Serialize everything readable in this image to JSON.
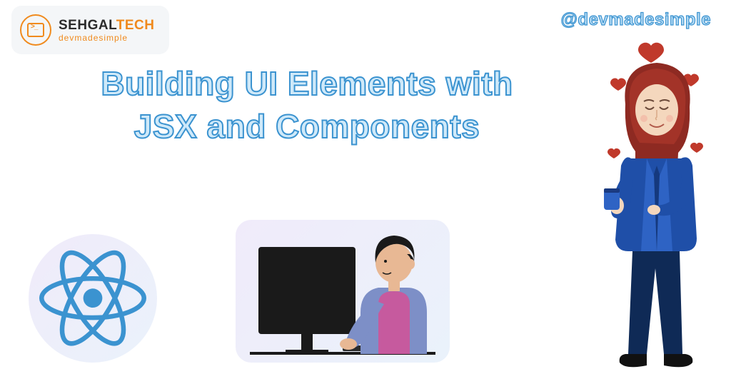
{
  "logo": {
    "brand_part1": "SEHGAL",
    "brand_part2": "TECH",
    "tagline": "devmadesimple"
  },
  "handle": "@devmadesimple",
  "title_line1": "Building UI Elements with",
  "title_line2": "JSX and Components",
  "icons": {
    "react": "react-logo",
    "coder": "person-coding-illustration",
    "person": "woman-hijab-holding-cup-illustration"
  },
  "colors": {
    "accent_blue": "#3b93d0",
    "light_blue": "#cfe9f9",
    "orange": "#f08a1d"
  }
}
